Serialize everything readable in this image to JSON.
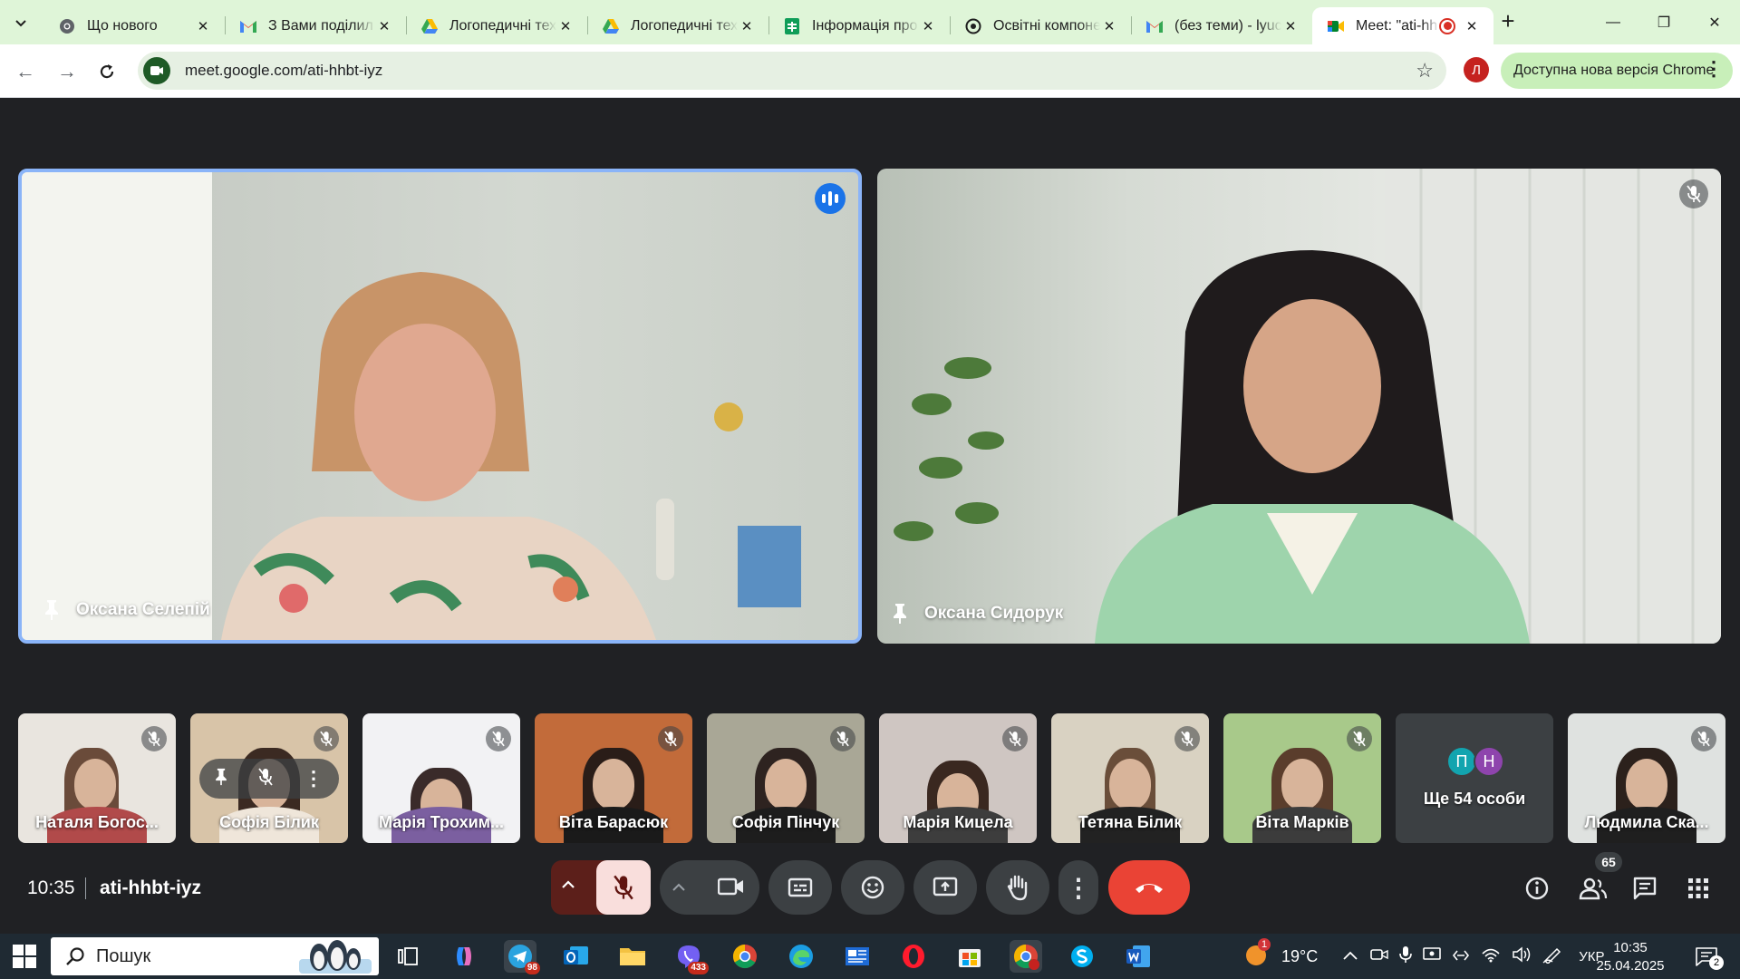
{
  "browser": {
    "tabs": [
      {
        "title": "Що нового",
        "favicon": "chrome-icon"
      },
      {
        "title": "З Вами поділил",
        "favicon": "gmail-icon"
      },
      {
        "title": "Логопедичні тех",
        "favicon": "google-drive-icon"
      },
      {
        "title": "Логопедичні тех",
        "favicon": "google-drive-icon"
      },
      {
        "title": "Інформація про",
        "favicon": "google-sheets-icon"
      },
      {
        "title": "Освітні компоне",
        "favicon": "google-classroom-icon"
      },
      {
        "title": "(без теми) - lyuc",
        "favicon": "gmail-icon"
      },
      {
        "title": "Meet: \"ati-hh",
        "favicon": "google-meet-icon"
      }
    ],
    "url": "meet.google.com/ati-hhbt-iyz",
    "profile_initial": "Л",
    "update_label": "Доступна нова версія Chrome"
  },
  "meet": {
    "main_tiles": [
      {
        "name": "Оксана Селепій",
        "speaking": true
      },
      {
        "name": "Оксана Сидорук",
        "muted": true
      }
    ],
    "thumbnails": [
      {
        "name": "Наталя Богос...",
        "muted": true
      },
      {
        "name": "Софія Білик",
        "muted": true
      },
      {
        "name": "Марія Трохим...",
        "muted": true
      },
      {
        "name": "Віта Барасюк",
        "muted": true
      },
      {
        "name": "Софія Пінчук",
        "muted": true
      },
      {
        "name": "Марія Кицела",
        "muted": true
      },
      {
        "name": "Тетяна Білик",
        "muted": true
      },
      {
        "name": "Віта Марків",
        "muted": true
      },
      {
        "name": "Ще 54 особи",
        "avatars": [
          "П",
          "Н"
        ]
      },
      {
        "name": "Людмила Ска...",
        "muted": true
      }
    ],
    "bottom_bar": {
      "time": "10:35",
      "meeting_code": "ati-hhbt-iyz",
      "participant_count": "65"
    }
  },
  "taskbar": {
    "search_placeholder": "Пошук",
    "badges": {
      "telegram": "98",
      "viber": "433"
    },
    "weather": "19°C",
    "language": "УКР",
    "time": "10:35",
    "date": "25.04.2025",
    "notifications": "2",
    "weather_alert": "1"
  },
  "colors": {
    "tab_strip": "#dff5d8",
    "meet_bg": "#202124",
    "speaking_border": "#8ab4f8",
    "end_call": "#ea4335",
    "mic_muted_bg": "#f9dedc"
  }
}
